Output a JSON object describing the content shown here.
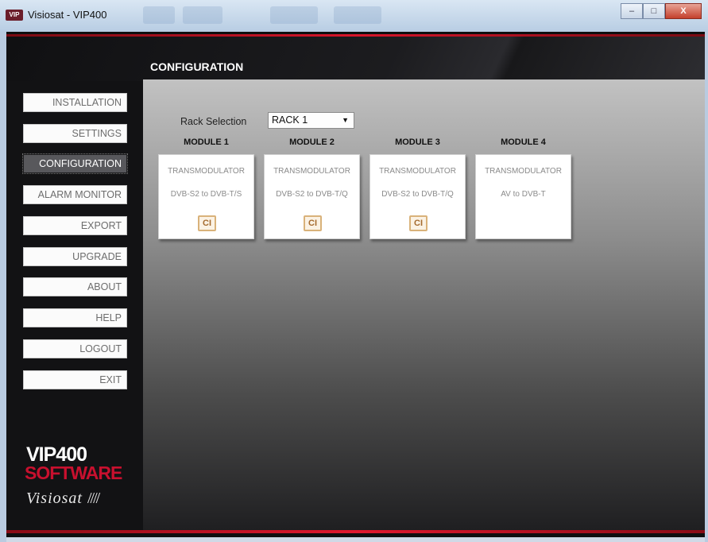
{
  "window": {
    "title": "Visiosat - VIP400",
    "icon_label": "VIP",
    "minimize": "–",
    "maximize": "□",
    "close": "X"
  },
  "header": {
    "title": "CONFIGURATION"
  },
  "sidebar": {
    "items": [
      {
        "label": "INSTALLATION"
      },
      {
        "label": "SETTINGS"
      },
      {
        "label": "CONFIGURATION",
        "active": true
      },
      {
        "label": "ALARM MONITOR"
      },
      {
        "label": "EXPORT"
      },
      {
        "label": "UPGRADE"
      },
      {
        "label": "ABOUT"
      },
      {
        "label": "HELP"
      },
      {
        "label": "LOGOUT"
      },
      {
        "label": "EXIT"
      }
    ]
  },
  "rack": {
    "label": "Rack Selection",
    "selected": "RACK 1",
    "arrow": "▼"
  },
  "modules": [
    {
      "heading": "MODULE 1",
      "type": "TRANSMODULATOR",
      "standard": "DVB-S2 to DVB-T/S",
      "ci": "CI"
    },
    {
      "heading": "MODULE 2",
      "type": "TRANSMODULATOR",
      "standard": "DVB-S2 to DVB-T/Q",
      "ci": "CI"
    },
    {
      "heading": "MODULE 3",
      "type": "TRANSMODULATOR",
      "standard": "DVB-S2 to DVB-T/Q",
      "ci": "CI"
    },
    {
      "heading": "MODULE 4",
      "type": "TRANSMODULATOR",
      "standard": "AV to DVB-T",
      "ci": null
    }
  ],
  "logo": {
    "line1": "VIP400",
    "line2": "SOFTWARE",
    "brand": "Visiosat"
  },
  "colors": {
    "accent_red": "#d8142a",
    "ci_badge": "#d9b27a",
    "active_nav": "#58585c"
  }
}
